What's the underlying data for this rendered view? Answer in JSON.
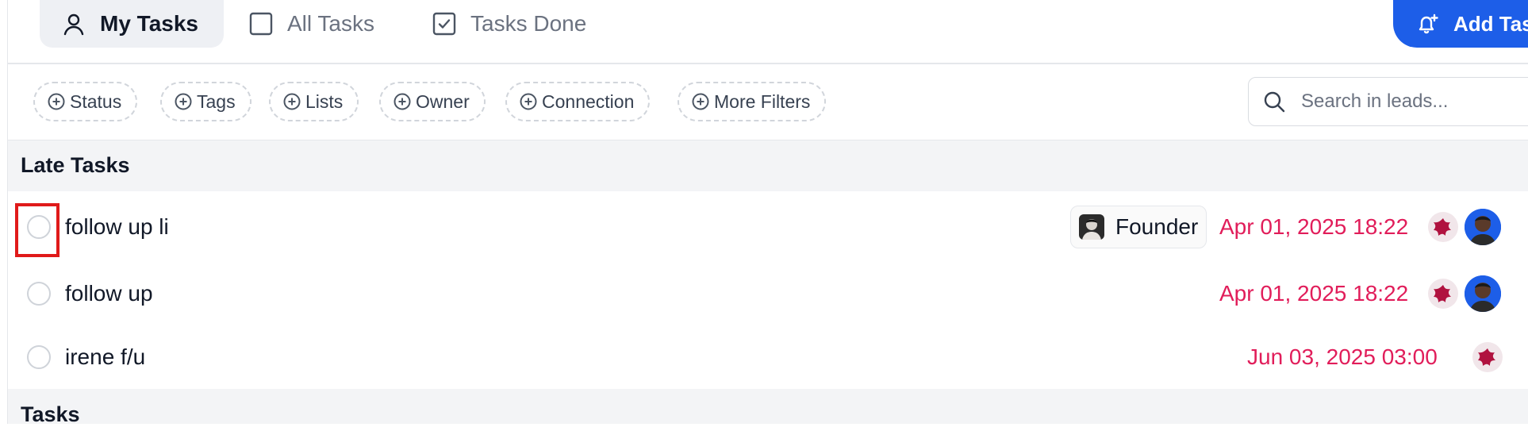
{
  "tabs": {
    "my_tasks": "My Tasks",
    "all_tasks": "All Tasks",
    "tasks_done": "Tasks Done"
  },
  "add_task_label": "Add Task",
  "filters": {
    "status": "Status",
    "tags": "Tags",
    "lists": "Lists",
    "owner": "Owner",
    "connection": "Connection",
    "more_filters": "More Filters"
  },
  "search": {
    "placeholder": "Search in leads..."
  },
  "sections": {
    "late": "Late Tasks",
    "tasks": "Tasks"
  },
  "late_tasks": [
    {
      "title": "follow up li",
      "tag": "Founder",
      "date": "Apr 01, 2025 18:22",
      "completed": false
    },
    {
      "title": "follow up",
      "date": "Apr 01, 2025 18:22",
      "completed": false
    },
    {
      "title": "irene f/u",
      "date": "Jun 03, 2025 03:00",
      "completed": false
    }
  ],
  "colors": {
    "accent": "#1d5ee8",
    "overdue_date": "#e11d5a",
    "star_icon": "#b0123f",
    "highlight": "#e01a1a"
  }
}
